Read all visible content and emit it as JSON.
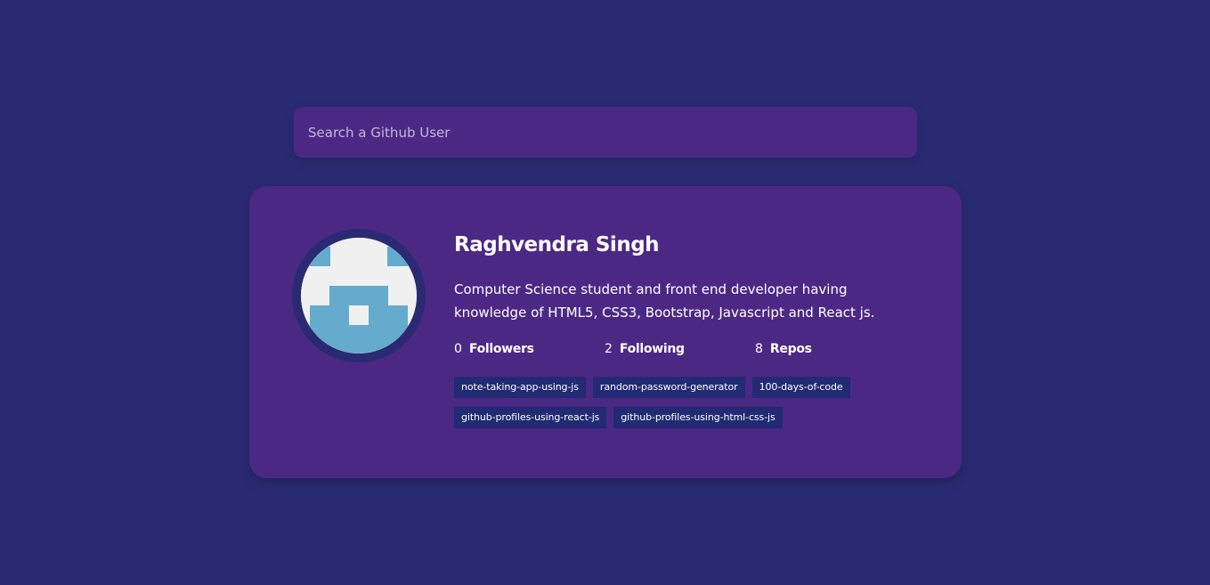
{
  "search": {
    "placeholder": "Search a Github User",
    "value": ""
  },
  "profile": {
    "name": "Raghvendra Singh",
    "bio": "Computer Science student and front end developer having knowledge of HTML5, CSS3, Bootstrap, Javascript and React js.",
    "avatar_icon": "identicon-avatar",
    "stats": {
      "followers_count": "0",
      "followers_label": "Followers",
      "following_count": "2",
      "following_label": "Following",
      "repos_count": "8",
      "repos_label": "Repos"
    },
    "repos": [
      "note-taking-app-using-js",
      "random-password-generator",
      "100-days-of-code",
      "github-profiles-using-react-js",
      "github-profiles-using-html-css-js"
    ]
  },
  "colors": {
    "background": "#2a2a72",
    "card": "#4c2885",
    "repo_chip": "#212a72",
    "avatar_accent": "#64abce",
    "avatar_bg": "#f0f0f0"
  }
}
